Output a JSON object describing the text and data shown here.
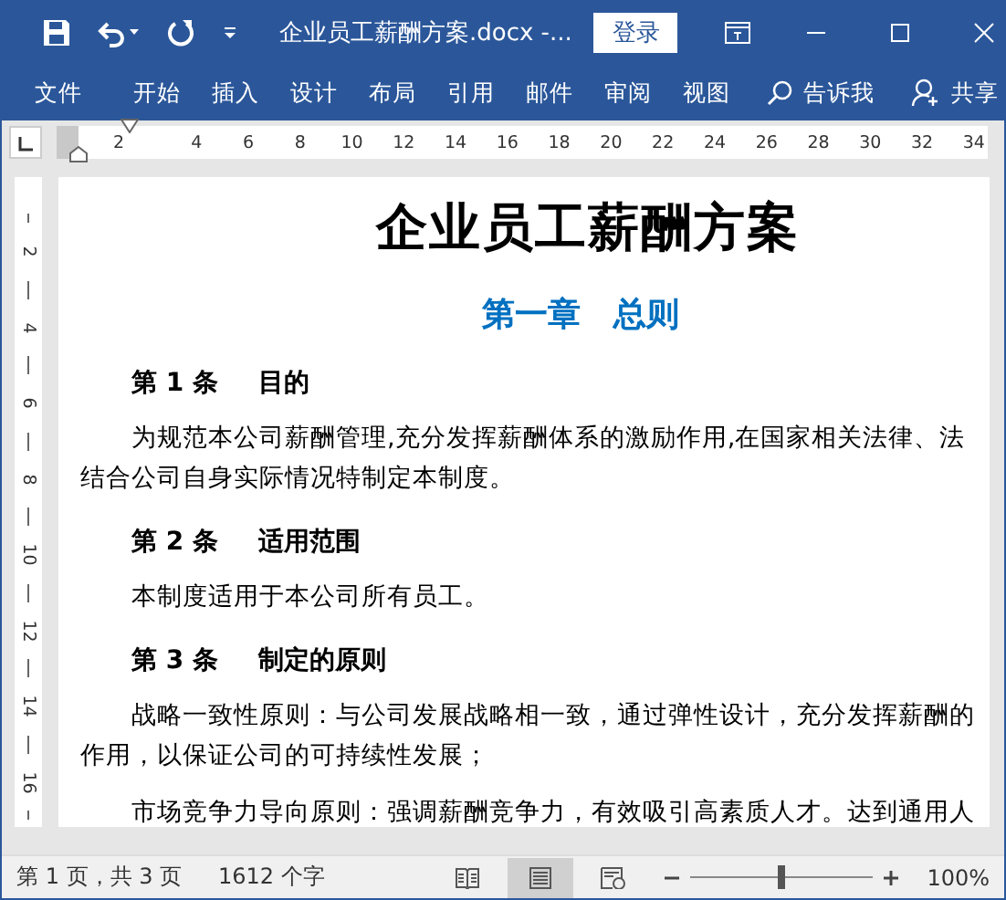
{
  "window": {
    "title": "企业员工薪酬方案.docx  -...",
    "sign_in": "登录"
  },
  "ribbon_tabs": [
    {
      "label": "文件"
    },
    {
      "label": "开始"
    },
    {
      "label": "插入"
    },
    {
      "label": "设计"
    },
    {
      "label": "布局"
    },
    {
      "label": "引用"
    },
    {
      "label": "邮件"
    },
    {
      "label": "审阅"
    },
    {
      "label": "视图"
    }
  ],
  "tell_me": "告诉我",
  "share": "共享",
  "ruler": {
    "marks": [
      "2",
      "4",
      "6",
      "8",
      "10",
      "12",
      "14",
      "16",
      "18",
      "20",
      "22",
      "24",
      "26",
      "28",
      "30",
      "32",
      "34"
    ]
  },
  "vertical_ruler": {
    "marks": [
      "2",
      "4",
      "6",
      "8",
      "10",
      "12",
      "14",
      "16"
    ]
  },
  "document": {
    "title": "企业员工薪酬方案",
    "chapter": "第一章　总则",
    "blocks": [
      {
        "kind": "heading",
        "number": "第 1 条",
        "title": "目的"
      },
      {
        "kind": "paragraph",
        "lines": [
          "为规范本公司薪酬管理,充分发挥薪酬体系的激励作用,在国家相关法律、法",
          "结合公司自身实际情况特制定本制度。"
        ]
      },
      {
        "kind": "heading",
        "number": "第 2 条",
        "title": "适用范围"
      },
      {
        "kind": "paragraph",
        "lines": [
          "本制度适用于本公司所有员工。"
        ]
      },
      {
        "kind": "heading",
        "number": "第 3 条",
        "title": "制定的原则"
      },
      {
        "kind": "paragraph",
        "lines": [
          "战略一致性原则：与公司发展战略相一致，通过弹性设计，充分发挥薪酬的",
          "作用，以保证公司的可持续性发展；"
        ]
      },
      {
        "kind": "paragraph",
        "lines": [
          "市场竞争力导向原则：强调薪酬竞争力，有效吸引高素质人才。达到通用人"
        ]
      }
    ]
  },
  "status_bar": {
    "page": "第 1 页，共 3 页",
    "words": "1612 个字",
    "views": [
      {
        "kind": "read",
        "selected": false
      },
      {
        "kind": "print",
        "selected": true
      },
      {
        "kind": "web",
        "selected": false
      }
    ],
    "zoom": {
      "level": 0.5,
      "reading": "100%"
    }
  }
}
